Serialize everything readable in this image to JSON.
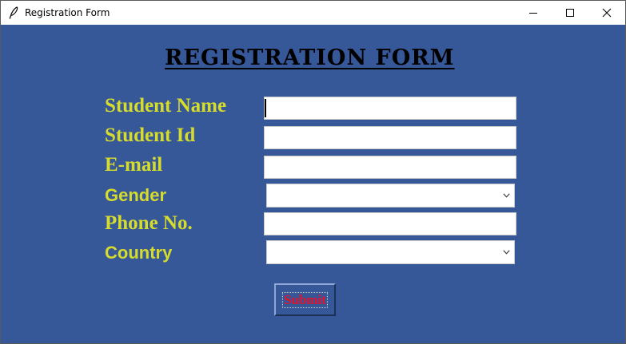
{
  "window": {
    "title": "Registration Form",
    "icon": "feather-icon"
  },
  "form": {
    "heading": "REGISTRATION FORM",
    "fields": {
      "student_name": {
        "label": "Student Name",
        "value": ""
      },
      "student_id": {
        "label": "Student Id",
        "value": ""
      },
      "email": {
        "label": "E-mail",
        "value": ""
      },
      "gender": {
        "label": "Gender",
        "selected": ""
      },
      "phone": {
        "label": "Phone No.",
        "value": ""
      },
      "country": {
        "label": "Country",
        "selected": ""
      }
    },
    "submit_label": "Submit"
  },
  "colors": {
    "background": "#365798",
    "label": "#d6dc2c",
    "heading": "#000000",
    "submit_text": "#e8102a"
  }
}
